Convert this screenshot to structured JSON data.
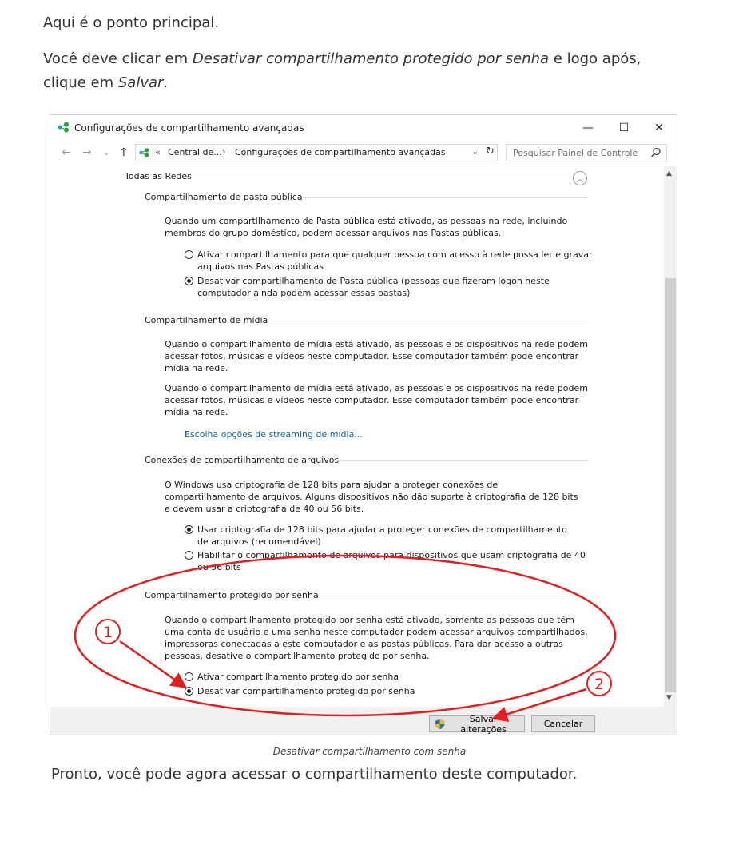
{
  "article": {
    "intro1": "Aqui é o ponto principal.",
    "intro2_a": "Você deve clicar em ",
    "intro2_em1": "Desativar compartilhamento protegido por senha",
    "intro2_b": " e logo após, clique em ",
    "intro2_em2": "Salvar",
    "intro2_c": ".",
    "caption": "Desativar compartilhamento com senha",
    "outro": "Pronto, você pode agora acessar o compartilhamento deste computador."
  },
  "window": {
    "title": "Configurações de compartilhamento avançadas",
    "controls": {
      "minimize": "—",
      "maximize": "☐",
      "close": "✕"
    }
  },
  "address": {
    "chevrons": "«",
    "crumb1": "Central de...",
    "separator": "›",
    "crumb2": "Configurações de compartilhamento avançadas",
    "search_placeholder": "Pesquisar Painel de Controle"
  },
  "sections": {
    "all_networks": "Todas as Redes",
    "public_folder": {
      "title": "Compartilhamento de pasta pública",
      "desc": "Quando um compartilhamento de Pasta pública está ativado, as pessoas na rede, incluindo membros do grupo doméstico, podem acessar arquivos nas Pastas públicas.",
      "opt1": "Ativar compartilhamento para que qualquer pessoa com acesso à rede possa ler e gravar arquivos nas Pastas públicas",
      "opt2": "Desativar compartilhamento de Pasta pública (pessoas que fizeram logon neste computador ainda podem acessar essas pastas)",
      "selected": "opt2"
    },
    "media": {
      "title": "Compartilhamento de mídia",
      "desc1": "Quando o compartilhamento de mídia está ativado, as pessoas e os dispositivos na rede podem acessar fotos, músicas e vídeos neste computador. Esse computador também pode encontrar mídia na rede.",
      "desc2": "Quando o compartilhamento de mídia está ativado, as pessoas e os dispositivos na rede podem acessar fotos, músicas e vídeos neste computador. Esse computador também pode encontrar mídia na rede.",
      "link": "Escolha opções de streaming de mídia..."
    },
    "file_sharing": {
      "title": "Conexões de compartilhamento de arquivos",
      "desc": "O Windows usa criptografia de 128 bits para ajudar a proteger conexões de compartilhamento de arquivos. Alguns dispositivos não dão suporte à criptografia de 128 bits e devem usar a criptografia de 40 ou 56 bits.",
      "opt1": "Usar criptografia de 128 bits para ajudar a proteger conexões de compartilhamento de arquivos (recomendável)",
      "opt2": "Habilitar o compartilhamento de arquivos para dispositivos que usam criptografia de 40 ou 56 bits",
      "selected": "opt1"
    },
    "password": {
      "title": "Compartilhamento protegido por senha",
      "desc": "Quando o compartilhamento protegido por senha está ativado, somente as pessoas que têm uma conta de usuário e uma senha neste computador podem acessar arquivos compartilhados, impressoras conectadas a este computador e as pastas públicas. Para dar acesso a outras pessoas, desative o compartilhamento protegido por senha.",
      "opt1": "Ativar compartilhamento protegido por senha",
      "opt2": "Desativar compartilhamento protegido por senha",
      "selected": "opt2"
    }
  },
  "footer": {
    "save": "Salvar alterações",
    "cancel": "Cancelar"
  },
  "annotations": {
    "marker1": "1",
    "marker2": "2",
    "color": "#e02020"
  },
  "colors": {
    "link": "#0a66b5",
    "footer_bg": "#f0f0f0"
  }
}
